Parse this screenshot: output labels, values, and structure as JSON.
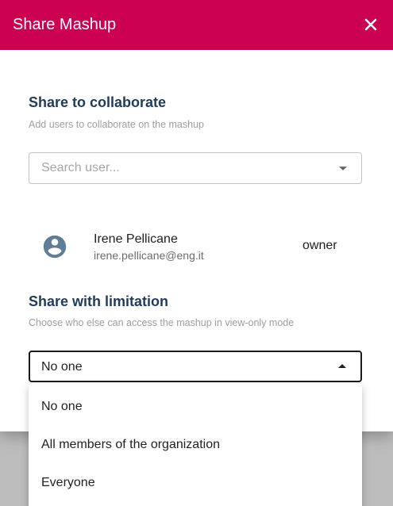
{
  "dialog": {
    "title": "Share Mashup",
    "header_color": "#cc0050",
    "close_icon": "close-icon"
  },
  "collaborate": {
    "title": "Share to collaborate",
    "description": "Add users to collaborate on the mashup",
    "search_placeholder": "Search user...",
    "search_value": ""
  },
  "users": [
    {
      "name": "Irene Pellicane",
      "email": "irene.pellicane@eng.it",
      "role": "owner",
      "icon": "account-circle-icon"
    }
  ],
  "limitation": {
    "title": "Share with limitation",
    "description": "Choose who else can access the mashup in view-only mode",
    "selected": "No one",
    "options": [
      "No one",
      "All members of the organization",
      "Everyone"
    ]
  }
}
